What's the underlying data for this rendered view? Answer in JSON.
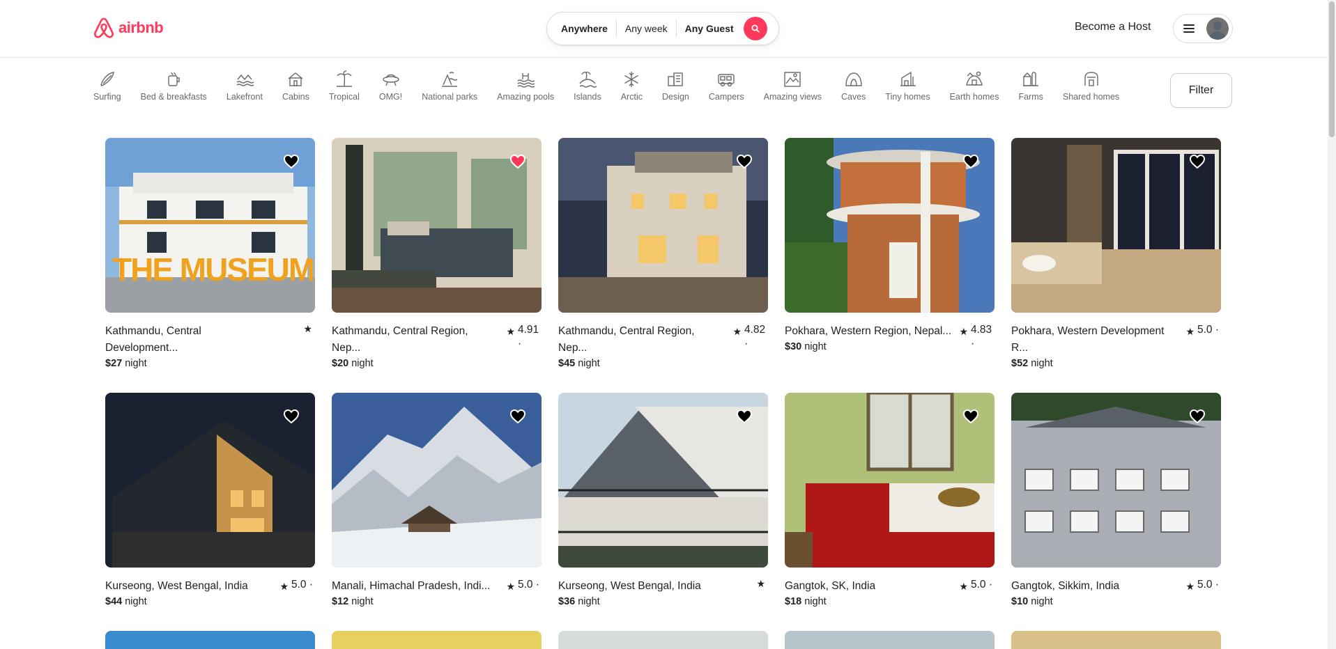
{
  "brand": {
    "name": "airbnb",
    "color": "#ff385c"
  },
  "search": {
    "where": "Anywhere",
    "when": "Any week",
    "who": "Any Guest",
    "icon": "search-icon"
  },
  "header": {
    "host_link": "Become a Host",
    "menu_icon": "menu-icon",
    "avatar_icon": "user-avatar"
  },
  "categories": [
    {
      "label": "Surfing",
      "icon": "surfing-icon"
    },
    {
      "label": "Bed & breakfasts",
      "icon": "bed-breakfast-icon"
    },
    {
      "label": "Lakefront",
      "icon": "lakefront-icon"
    },
    {
      "label": "Cabins",
      "icon": "cabin-icon"
    },
    {
      "label": "Tropical",
      "icon": "palm-tree-icon"
    },
    {
      "label": "OMG!",
      "icon": "ufo-icon"
    },
    {
      "label": "National parks",
      "icon": "national-park-icon"
    },
    {
      "label": "Amazing pools",
      "icon": "pool-icon"
    },
    {
      "label": "Islands",
      "icon": "island-icon"
    },
    {
      "label": "Arctic",
      "icon": "snowflake-icon"
    },
    {
      "label": "Design",
      "icon": "design-icon"
    },
    {
      "label": "Campers",
      "icon": "camper-icon"
    },
    {
      "label": "Amazing views",
      "icon": "view-icon"
    },
    {
      "label": "Caves",
      "icon": "cave-icon"
    },
    {
      "label": "Tiny homes",
      "icon": "tiny-home-icon"
    },
    {
      "label": "Earth homes",
      "icon": "earth-home-icon"
    },
    {
      "label": "Farms",
      "icon": "farm-icon"
    },
    {
      "label": "Shared homes",
      "icon": "shared-home-icon"
    }
  ],
  "filter_label": "Filter",
  "price_suffix": "night",
  "listings": [
    {
      "location": "Kathmandu, Central Development...",
      "rating": "",
      "price": "$27",
      "favorited": false,
      "photo": "white museum building with yellow THE MUSEUM letters",
      "photo_text": "THE MUSEUM"
    },
    {
      "location": "Kathmandu, Central Region, Nep...",
      "rating": "4.91 ·",
      "price": "$20",
      "favorited": true,
      "photo": "bedroom with green curtains"
    },
    {
      "location": "Kathmandu, Central Region, Nep...",
      "rating": "4.82 ·",
      "price": "$45",
      "favorited": false,
      "photo": "house lit at dusk"
    },
    {
      "location": "Pokhara, Western Region, Nepal...",
      "rating": "4.83 ·",
      "price": "$30",
      "favorited": false,
      "photo": "round balcony tower house"
    },
    {
      "location": "Pokhara, Western Development R...",
      "rating": "5.0 ·",
      "price": "$52",
      "favorited": false,
      "photo": "bedroom with plaid curtain"
    },
    {
      "location": "Kurseong, West Bengal, India",
      "rating": "5.0 ·",
      "price": "$44",
      "favorited": false,
      "photo": "a-frame house at night"
    },
    {
      "location": "Manali, Himachal Pradesh, Indi...",
      "rating": "5.0 ·",
      "price": "$12",
      "favorited": false,
      "photo": "snowy mountain cabin"
    },
    {
      "location": "Kurseong, West Bengal, India",
      "rating": "",
      "price": "$36",
      "favorited": false,
      "photo": "a-frame house daytime"
    },
    {
      "location": "Gangtok, SK, India",
      "rating": "5.0 ·",
      "price": "$18",
      "favorited": false,
      "photo": "bed with red cover"
    },
    {
      "location": "Gangtok, Sikkim, India",
      "rating": "5.0 ·",
      "price": "$10",
      "favorited": false,
      "photo": "multi-storey building with windows"
    }
  ]
}
